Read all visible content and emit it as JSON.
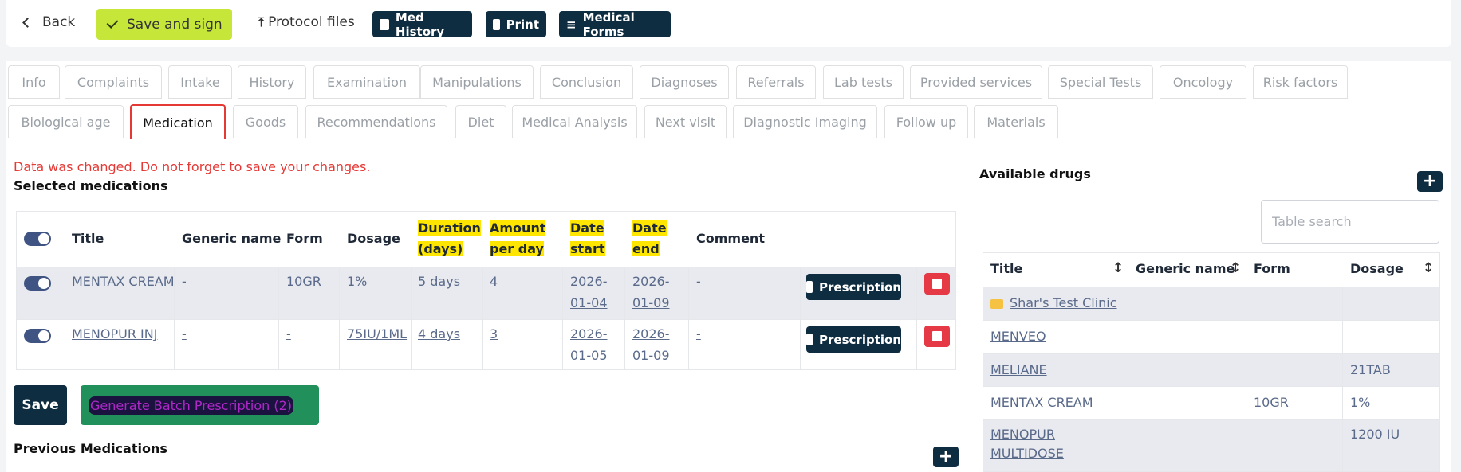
{
  "toolbar": {
    "back_label": "Back",
    "save_sign_label": "Save and sign",
    "protocol_label": "Protocol files",
    "med_history_label": "Med History",
    "print_label": "Print",
    "medical_forms_label": "Medical Forms"
  },
  "tabs_row1": [
    "Info",
    "Complaints",
    "Intake",
    "History",
    "Examination",
    "Manipulations",
    "Conclusion",
    "Diagnoses",
    "Referrals",
    "Lab tests",
    "Provided services",
    "Special Tests",
    "Oncology",
    "Risk factors"
  ],
  "tabs_row2": [
    "Biological age",
    "Medication",
    "Goods",
    "Recommendations",
    "Diet",
    "Medical Analysis",
    "Next visit",
    "Diagnostic Imaging",
    "Follow up",
    "Materials"
  ],
  "active_tab": "Medication",
  "warning": "Data was changed. Do not forget to save your changes.",
  "selected": {
    "title": "Selected medications",
    "headers": {
      "title": "Title",
      "generic": "Generic name",
      "form": "Form",
      "dosage": "Dosage",
      "duration_1": "Duration",
      "duration_2": "(days)",
      "amount_1": "Amount",
      "amount_2": "per day",
      "start_1": "Date",
      "start_2": "start",
      "end_1": "Date",
      "end_2": "end",
      "comment": "Comment"
    },
    "rows": [
      {
        "title": "MENTAX CREAM",
        "generic": "-",
        "form": "10GR",
        "dosage": "1%",
        "duration": "5 days",
        "amount": "4",
        "start_1": "2026-",
        "start_2": "01-04",
        "end_1": "2026-",
        "end_2": "01-09",
        "comment": "-"
      },
      {
        "title": "MENOPUR INJ",
        "generic": "-",
        "form": "-",
        "dosage": "75IU/1ML",
        "duration": "4 days",
        "amount": "3",
        "start_1": "2026-",
        "start_2": "01-05",
        "end_1": "2026-",
        "end_2": "01-09",
        "comment": "-"
      }
    ],
    "prescription_label": "Prescription"
  },
  "save_label": "Save",
  "batch_label": "Generate Batch Prescription (2)",
  "previous_title": "Previous Medications",
  "available": {
    "title": "Available drugs",
    "search_placeholder": "Table search",
    "headers": {
      "title": "Title",
      "generic": "Generic name",
      "form": "Form",
      "dosage": "Dosage"
    },
    "folder": "Shar's Test Clinic",
    "rows": [
      {
        "title": "MENVEO",
        "generic": "",
        "form": "",
        "dosage": ""
      },
      {
        "title": "MELIANE",
        "generic": "",
        "form": "",
        "dosage": "21TAB"
      },
      {
        "title": "MENTAX CREAM",
        "generic": "",
        "form": "10GR",
        "dosage": "1%"
      },
      {
        "title_1": "MENOPUR",
        "title_2": "MULTIDOSE",
        "generic": "",
        "form": "",
        "dosage": "1200 IU"
      }
    ]
  }
}
